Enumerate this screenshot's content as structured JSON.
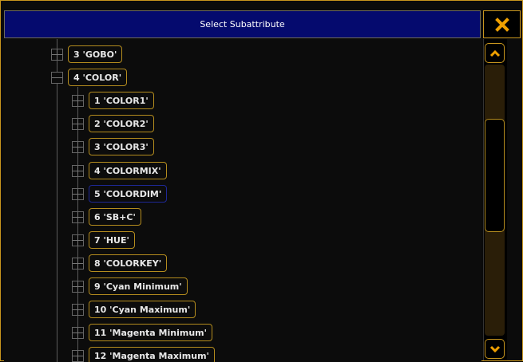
{
  "dialog": {
    "title": "Select Subattribute",
    "close_icon": "close-icon"
  },
  "tree": {
    "items": [
      {
        "label": "3 'GOBO'",
        "level": 1,
        "expanded": false
      },
      {
        "label": "4 'COLOR'",
        "level": 1,
        "expanded": true
      },
      {
        "label": "1 'COLOR1'",
        "level": 2,
        "expanded": false
      },
      {
        "label": "2 'COLOR2'",
        "level": 2,
        "expanded": false
      },
      {
        "label": "3 'COLOR3'",
        "level": 2,
        "expanded": false
      },
      {
        "label": "4 'COLORMIX'",
        "level": 2,
        "expanded": false
      },
      {
        "label": "5 'COLORDIM'",
        "level": 2,
        "expanded": false,
        "selected": true
      },
      {
        "label": "6 'SB+C'",
        "level": 2,
        "expanded": false
      },
      {
        "label": "7 'HUE'",
        "level": 2,
        "expanded": false
      },
      {
        "label": "8 'COLORKEY'",
        "level": 2,
        "expanded": false
      },
      {
        "label": "9 'Cyan Minimum'",
        "level": 2,
        "expanded": false
      },
      {
        "label": "10 'Cyan Maximum'",
        "level": 2,
        "expanded": false
      },
      {
        "label": "11 'Magenta Minimum'",
        "level": 2,
        "expanded": false
      },
      {
        "label": "12 'Magenta Maximum'",
        "level": 2,
        "expanded": false
      }
    ]
  },
  "scrollbar": {
    "up_icon": "chevron-up-icon",
    "down_icon": "chevron-down-icon"
  },
  "colors": {
    "accent": "#f0a000",
    "title_bg": "#050a6e",
    "border": "#b48c1e"
  }
}
